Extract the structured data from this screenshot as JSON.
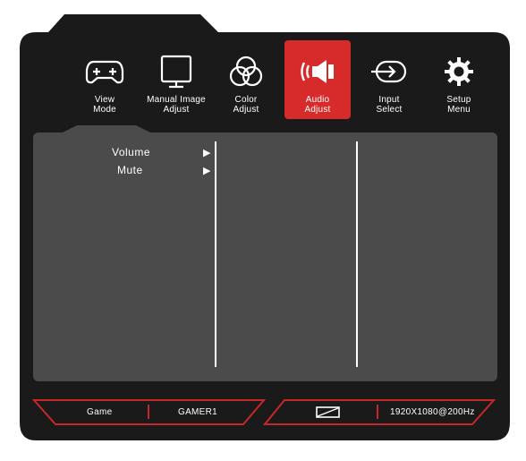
{
  "menu": {
    "items": [
      {
        "id": "view-mode",
        "label": "View\nMode",
        "icon": "gamepad-icon",
        "active": false
      },
      {
        "id": "manual-image-adjust",
        "label": "Manual Image\nAdjust",
        "icon": "monitor-icon",
        "active": false
      },
      {
        "id": "color-adjust",
        "label": "Color\nAdjust",
        "icon": "rgb-circles-icon",
        "active": false
      },
      {
        "id": "audio-adjust",
        "label": "Audio\nAdjust",
        "icon": "speaker-icon",
        "active": true
      },
      {
        "id": "input-select",
        "label": "Input\nSelect",
        "icon": "input-arrow-icon",
        "active": false
      },
      {
        "id": "setup-menu",
        "label": "Setup\nMenu",
        "icon": "gear-icon",
        "active": false
      }
    ]
  },
  "submenu": {
    "items": [
      {
        "label": "Volume",
        "arrow": "▶"
      },
      {
        "label": "Mute",
        "arrow": "▶"
      }
    ]
  },
  "status": {
    "mode": "Game",
    "profile": "GAMER1",
    "resolution": "1920X1080@200Hz",
    "aspect_icon": "aspect-ratio-icon"
  },
  "colors": {
    "accent": "#d72a2a",
    "frame": "#1a1a1a",
    "panel": "#4b4b4b",
    "status_red": "#c62828"
  }
}
